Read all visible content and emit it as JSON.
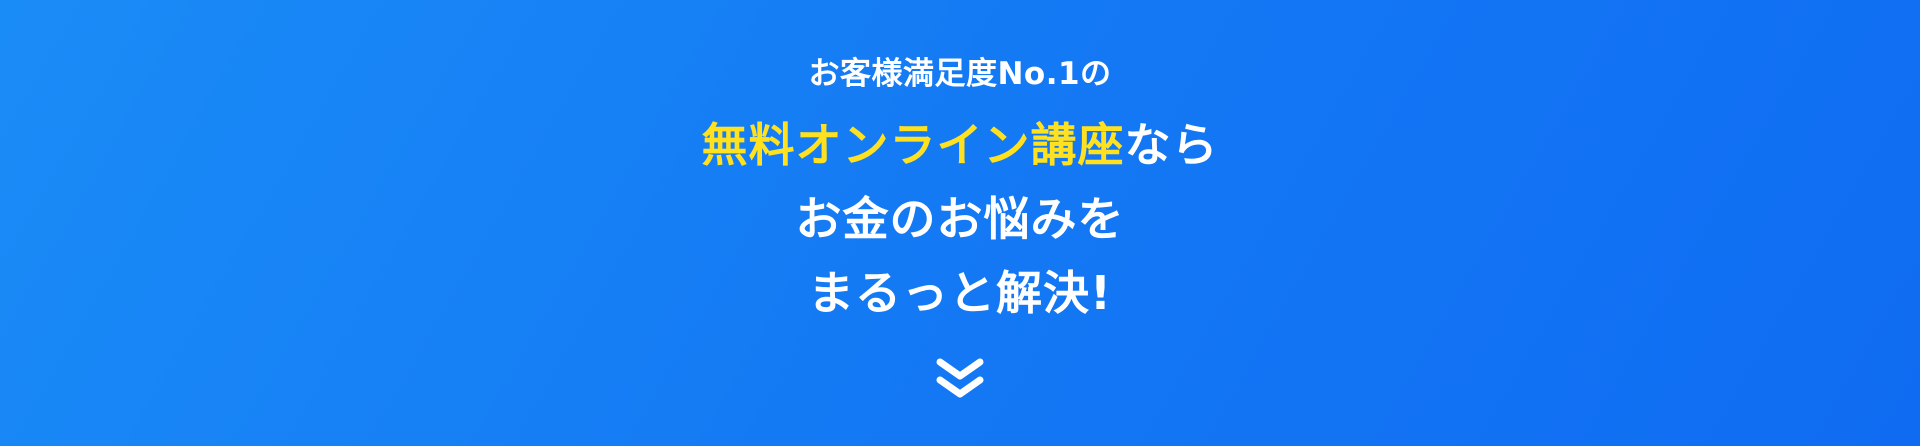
{
  "hero": {
    "kicker": "お客様満足度No.1の",
    "headline": {
      "line1_highlight": "無料オンライン講座",
      "line1_rest": "なら",
      "line2": "お金のお悩みを",
      "line3": "まるっと解決!"
    },
    "scroll_icon": "double-chevron-down-icon"
  },
  "colors": {
    "background_start": "#1a8cf7",
    "background_end": "#0f6cf2",
    "text": "#ffffff",
    "highlight": "#ffe11f"
  }
}
